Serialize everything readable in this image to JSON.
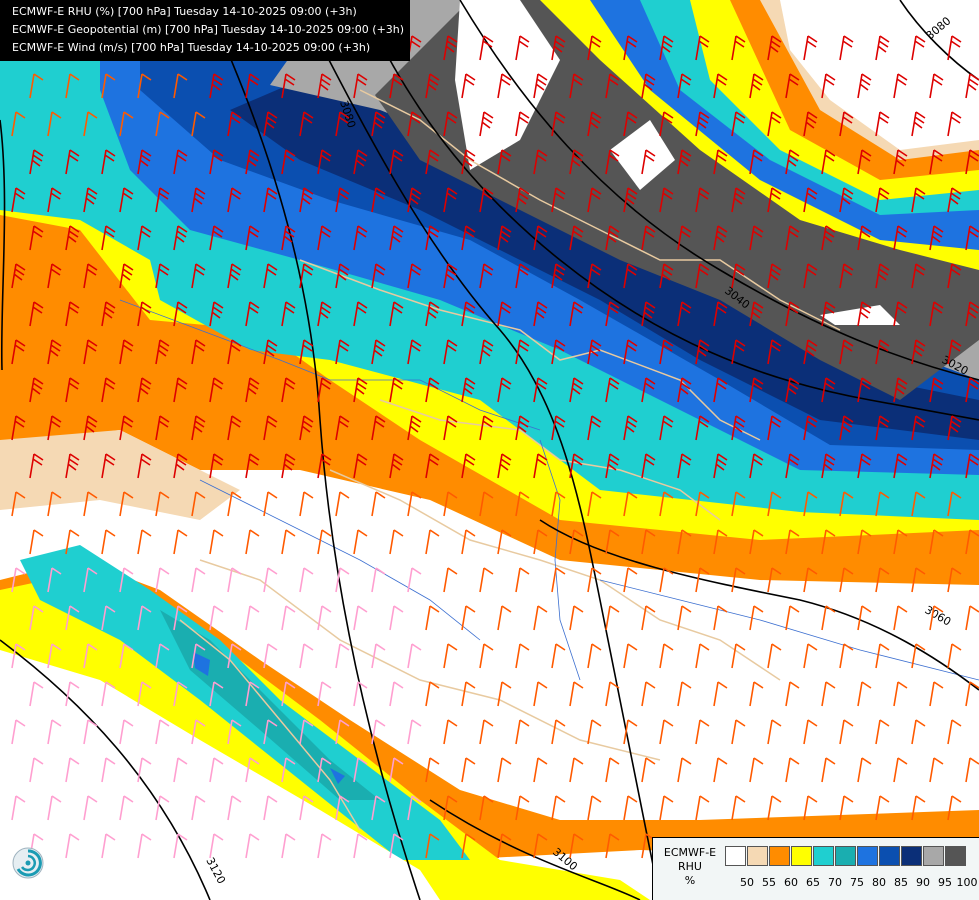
{
  "header": {
    "line1": "ECMWF-E RHU (%) [700 hPa] Tuesday 14-10-2025 09:00 (+3h)",
    "line2": "ECMWF-E Geopotential (m) [700 hPa] Tuesday 14-10-2025 09:00 (+3h)",
    "line3": "ECMWF-E Wind (m/s) [700 hPa] Tuesday 14-10-2025 09:00 (+3h)"
  },
  "legend": {
    "title_line1": "ECMWF-E",
    "title_line2": "RHU",
    "unit": "%",
    "levels": [
      "50",
      "55",
      "60",
      "65",
      "70",
      "75",
      "80",
      "85",
      "90",
      "95",
      "100"
    ],
    "colors": [
      "#ffffff",
      "#f5d9b4",
      "#ff8c00",
      "#ffff00",
      "#1fcfd0",
      "#1aaeb0",
      "#1e73e0",
      "#0b4fb0",
      "#0b2f78",
      "#a8a8a8",
      "#555555"
    ]
  },
  "contours": {
    "labels": [
      "3080",
      "3080",
      "3040",
      "3020",
      "3060",
      "3100",
      "3120"
    ]
  },
  "colors": {
    "wind_barb_strong": "#dd0000",
    "wind_barb_mid": "#ff5a00",
    "wind_barb_weak": "#ff9fd0",
    "border_line": "#e8caa0",
    "river_line": "#3c6fd0"
  }
}
